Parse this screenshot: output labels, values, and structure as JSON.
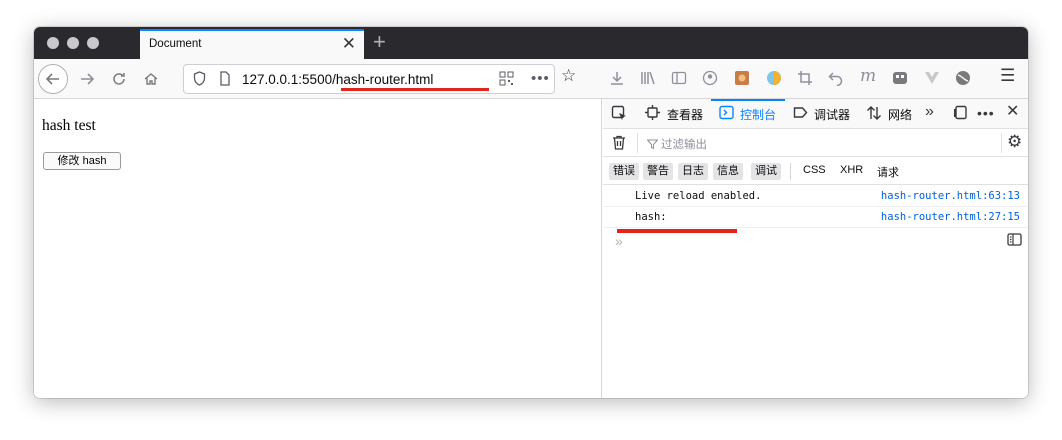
{
  "browser": {
    "tab_title": "Document",
    "tab_close": "✕",
    "new_tab": "+",
    "url": "127.0.0.1:5500/hash-router.html"
  },
  "page": {
    "heading": "hash test",
    "button_label": "修改 hash"
  },
  "devtools": {
    "tabs": {
      "inspector": "查看器",
      "console": "控制台",
      "debugger": "调试器",
      "network": "网络"
    },
    "filter_placeholder": "过滤输出",
    "levels": [
      "错误",
      "警告",
      "日志",
      "信息",
      "调试"
    ],
    "categories": [
      "CSS",
      "XHR",
      "请求"
    ],
    "logs": [
      {
        "message": "Live reload enabled.",
        "location": "hash-router.html:63:13"
      },
      {
        "message": "hash:",
        "location": "hash-router.html:27:15"
      }
    ],
    "prompt": "»"
  },
  "colors": {
    "accent": "#0a84ff",
    "highlight": "#e3241d",
    "titlebar": "#2a2a2e"
  }
}
